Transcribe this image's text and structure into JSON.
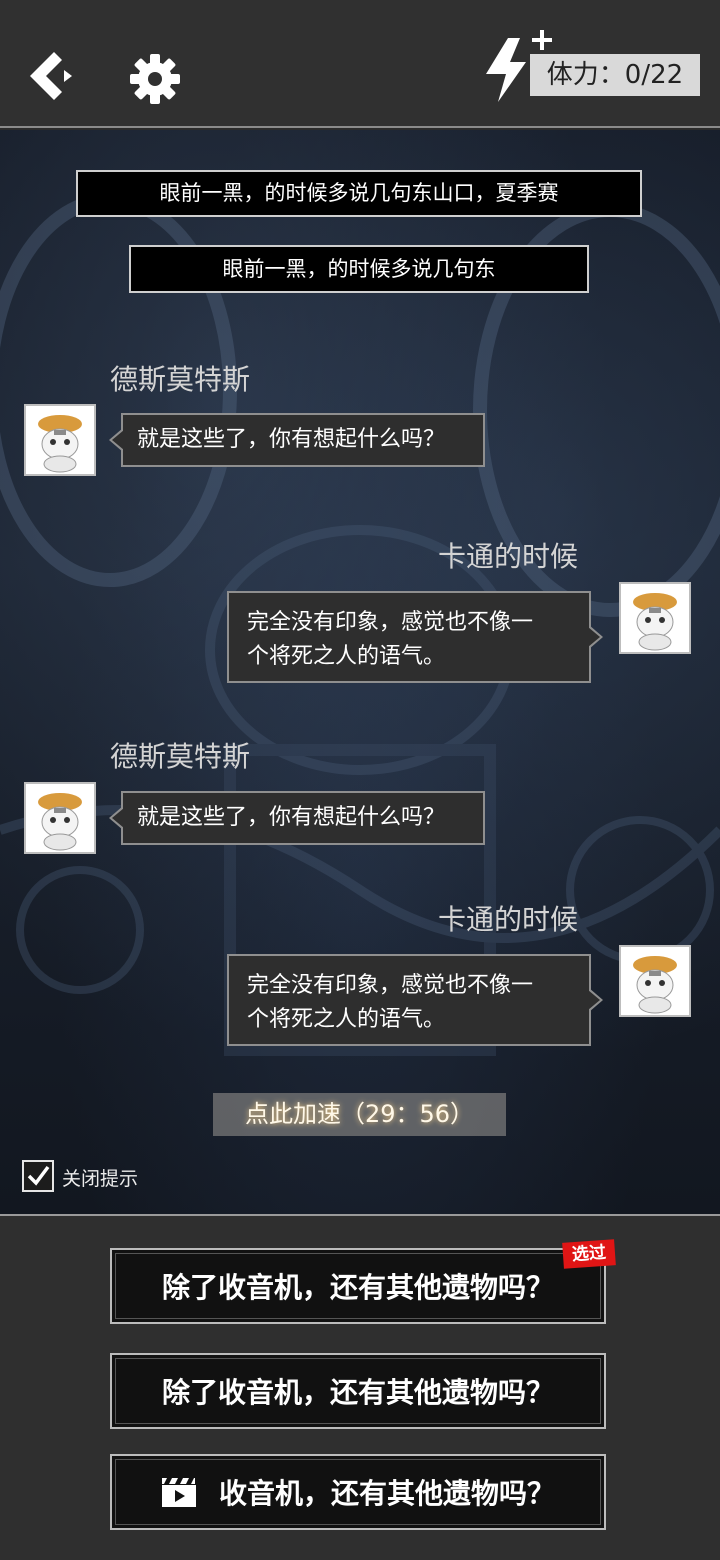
{
  "header": {
    "back_icon": "back-arrow-icon",
    "settings_icon": "gear-icon",
    "stamina_icon": "lightning-icon",
    "stamina_plus": "+",
    "stamina_text": "体力：0/22"
  },
  "notices": [
    "眼前一黑，的时候多说几句东山口，夏季赛",
    "眼前一黑，的时候多说几句东"
  ],
  "chat": [
    {
      "side": "left",
      "speaker": "德斯莫特斯",
      "text": "就是这些了，你有想起什么吗？"
    },
    {
      "side": "right",
      "speaker": "卡通的时候",
      "text_lines": [
        "完全没有印象，感觉也不像一",
        "个将死之人的语气。"
      ]
    },
    {
      "side": "left",
      "speaker": "德斯莫特斯",
      "text": "就是这些了，你有想起什么吗？"
    },
    {
      "side": "right",
      "speaker": "卡通的时候",
      "text_lines": [
        "完全没有印象，感觉也不像一",
        "个将死之人的语气。"
      ]
    }
  ],
  "speedup_label": "点此加速（29：56）",
  "close_tip": {
    "label": "关闭提示",
    "checked": true
  },
  "choices": [
    {
      "label": "除了收音机，还有其他遗物吗？",
      "badge": "选过"
    },
    {
      "label": "除了收音机，还有其他遗物吗？"
    },
    {
      "label": "收音机，还有其他遗物吗？",
      "icon": "video-clapper-icon"
    }
  ],
  "colors": {
    "badge_red": "#e01515",
    "panel": "#2f2f2f",
    "topbar": "#303030"
  }
}
